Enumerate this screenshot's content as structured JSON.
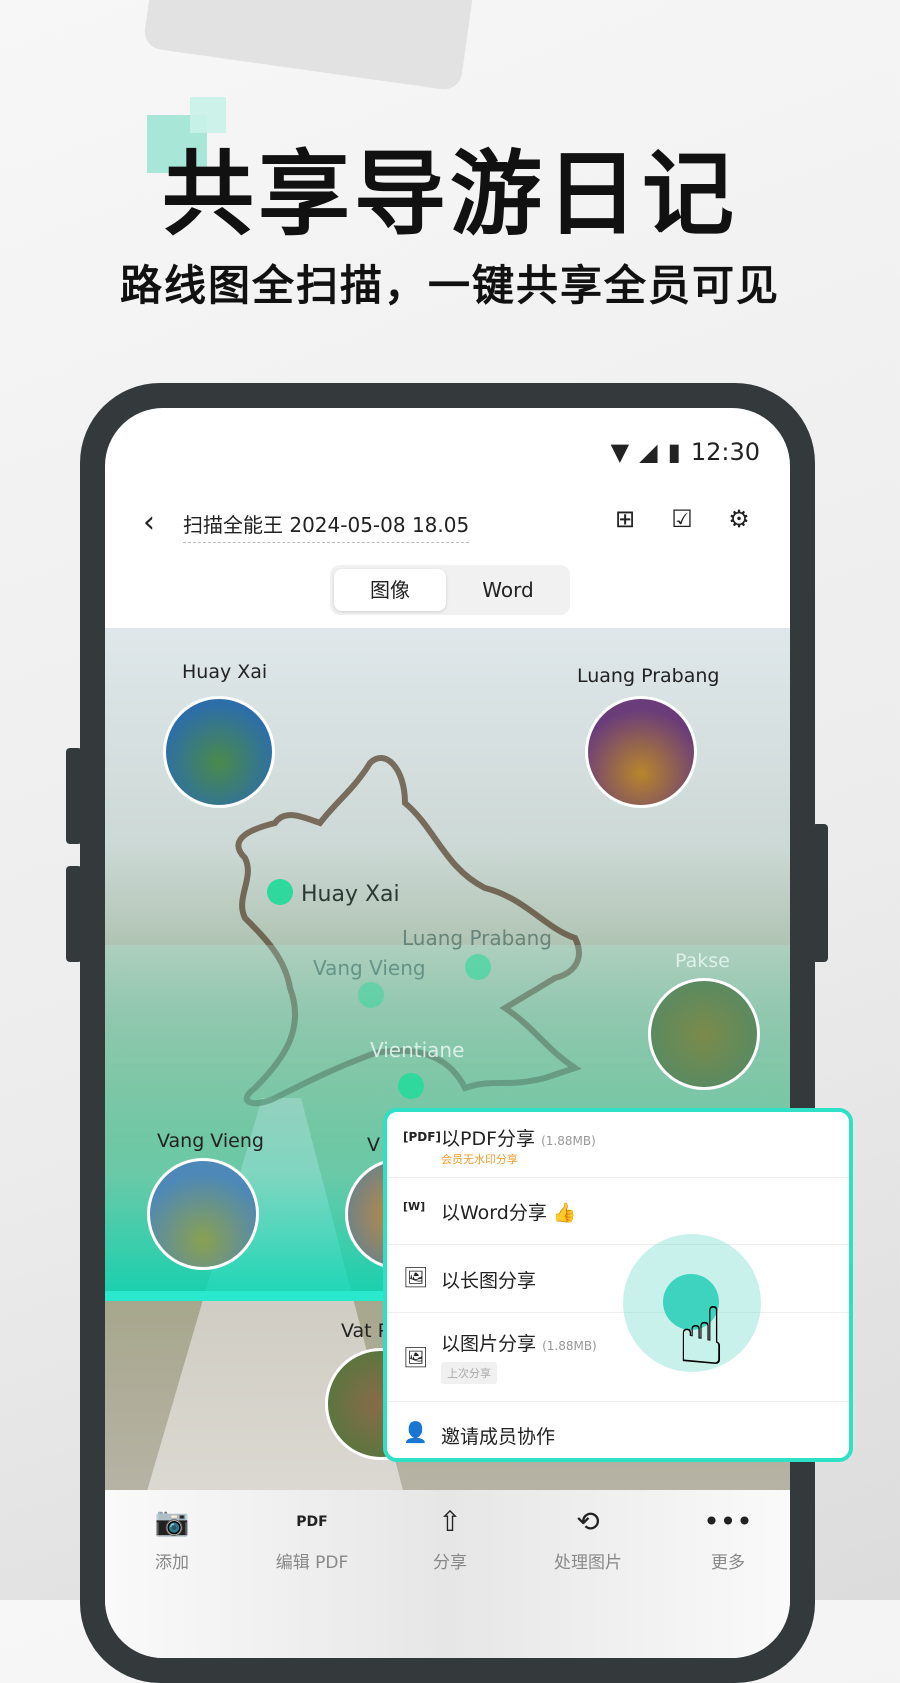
{
  "promo": {
    "title": "共享导游日记",
    "subtitle": "路线图全扫描，一键共享全员可见"
  },
  "status": {
    "time": "12:30"
  },
  "header": {
    "back": "‹",
    "doc_title": "扫描全能王 2024-05-08 18.05"
  },
  "tabs": [
    {
      "label": "图像",
      "active": true
    },
    {
      "label": "Word",
      "active": false
    }
  ],
  "map": {
    "photo_labels": [
      "Huay Xai",
      "Luang Prabang",
      "Pakse",
      "Vang Vieng",
      "V",
      "Vat P"
    ],
    "route_labels": [
      "Huay Xai",
      "Luang Prabang",
      "Vang Vieng",
      "Vientiane"
    ]
  },
  "share_menu": {
    "items": [
      {
        "label": "以PDF分享",
        "size": "(1.88MB)",
        "sub": "会员无水印分享",
        "icon": "pdf-icon"
      },
      {
        "label": "以Word分享",
        "icon": "word-icon",
        "badge_icon": "thumbs-up-icon"
      },
      {
        "label": "以长图分享",
        "icon": "long-image-icon"
      },
      {
        "label": "以图片分享",
        "size": "(1.88MB)",
        "tag": "上次分享",
        "icon": "image-icon"
      },
      {
        "label": "邀请成员协作",
        "icon": "add-person-icon"
      }
    ]
  },
  "accent": "#2ee0c6",
  "bottom_bar": [
    {
      "label": "添加",
      "icon": "camera-add-icon"
    },
    {
      "label": "编辑 PDF",
      "icon": "pdf-file-icon"
    },
    {
      "label": "分享",
      "icon": "share-icon"
    },
    {
      "label": "处理图片",
      "icon": "crop-rotate-icon"
    },
    {
      "label": "更多",
      "icon": "more-icon"
    }
  ]
}
